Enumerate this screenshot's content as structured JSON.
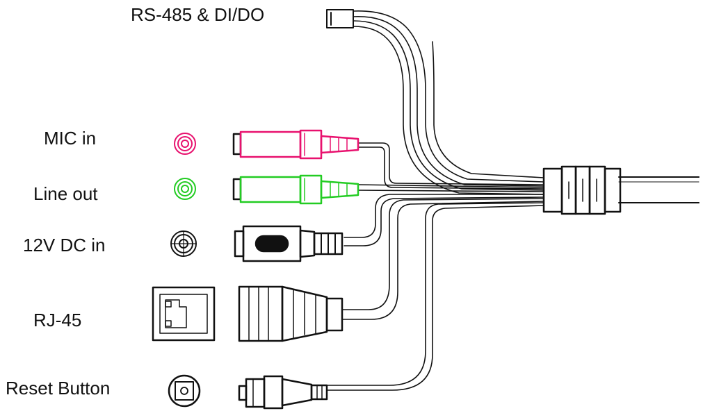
{
  "labels": {
    "rs485": "RS-485 & DI/DO",
    "mic_in": "MIC in",
    "line_out": "Line out",
    "dc_in": "12V DC in",
    "rj45": "RJ-45",
    "reset": "Reset Button"
  },
  "colors": {
    "mic": "#e8116e",
    "line_out": "#22cc22",
    "outline": "#111111",
    "background": "#ffffff"
  },
  "icons": [
    "audio-jack-icon",
    "dc-jack-icon",
    "rj45-port-icon",
    "reset-button-icon"
  ]
}
